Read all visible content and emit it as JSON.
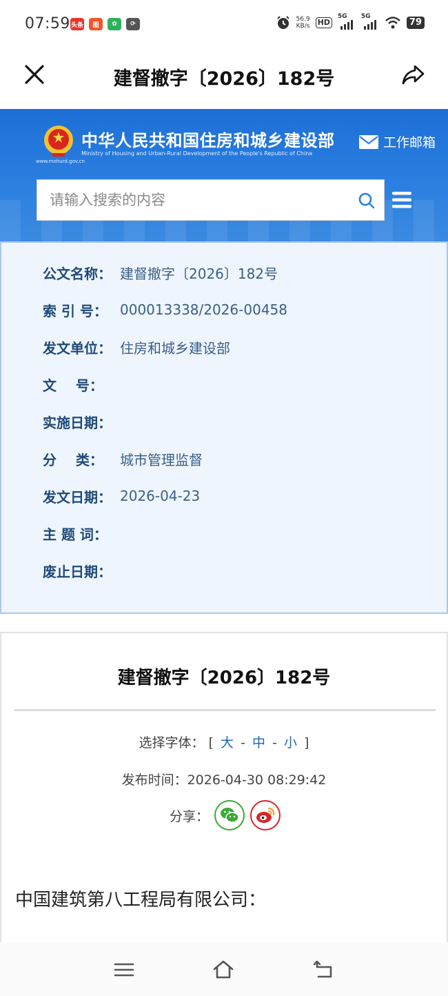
{
  "status_bar": {
    "time": "07:59",
    "app_icons": [
      {
        "label": "头条",
        "color": "#e8352d"
      },
      {
        "label": "图",
        "color": "#f0562a"
      },
      {
        "label": "✿",
        "color": "#2db35d"
      },
      {
        "label": "⟳",
        "color": "#555555"
      }
    ],
    "net_speed_value": "56.9",
    "net_speed_unit": "KB/s",
    "hd_badge": "HD",
    "signal1": "5G",
    "signal2": "5G",
    "battery": "79"
  },
  "nav": {
    "title": "建督撤字〔2026〕182号"
  },
  "header": {
    "ministry_cn": "中华人民共和国住房和城乡建设部",
    "ministry_en": "Ministry of Housing and Urban-Rural Development of the People's Republic of China",
    "site_url": "www.mohurd.gov.cn",
    "mailbox_label": "工作邮箱",
    "search_placeholder": "请输入搜索的内容"
  },
  "meta": {
    "rows": [
      {
        "label": "公文名称：",
        "value": "建督撤字〔2026〕182号"
      },
      {
        "label": "索 引 号：",
        "value": "000013338/2026-00458"
      },
      {
        "label": "发文单位：",
        "value": "住房和城乡建设部"
      },
      {
        "label": "文    号：",
        "value": ""
      },
      {
        "label": "实施日期：",
        "value": ""
      },
      {
        "label": "分    类：",
        "value": "城市管理监督"
      },
      {
        "label": "发文日期：",
        "value": "2026-04-23"
      },
      {
        "label": "主 题 词：",
        "value": ""
      },
      {
        "label": "废止日期：",
        "value": ""
      }
    ]
  },
  "document": {
    "title": "建督撤字〔2026〕182号",
    "font_select_label": "选择字体：",
    "bracket_open": "[",
    "bracket_close": "]",
    "font_large": "大",
    "font_medium": "中",
    "font_small": "小",
    "separator": "-",
    "publish_time": "发布时间：2026-04-30 08:29:42",
    "share_label": "分享：",
    "recipient": "中国建筑第八工程局有限公司："
  },
  "colors": {
    "banner_blue": "#2a7fe0",
    "meta_bg": "#eef5fc",
    "meta_label": "#1f4a78",
    "link_blue": "#1f64b6",
    "wechat_green": "#3aaa35",
    "weibo_red": "#d8262b"
  }
}
